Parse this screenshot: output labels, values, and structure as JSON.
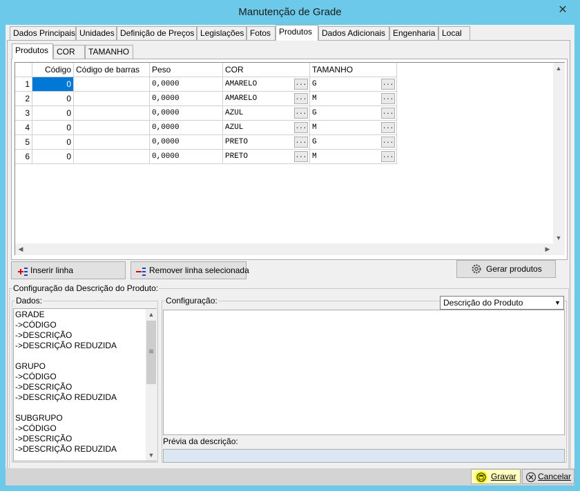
{
  "window": {
    "title": "Manutenção de Grade",
    "close_glyph": "✕"
  },
  "tabs": [
    {
      "label": "Dados Principais"
    },
    {
      "label": "Unidades"
    },
    {
      "label": "Definição de Preços"
    },
    {
      "label": "Legislações"
    },
    {
      "label": "Fotos"
    },
    {
      "label": "Produtos",
      "active": true
    },
    {
      "label": "Dados Adicionais"
    },
    {
      "label": "Engenharia"
    },
    {
      "label": "Local"
    }
  ],
  "subtabs": [
    {
      "label": "Produtos",
      "active": true
    },
    {
      "label": "COR"
    },
    {
      "label": "TAMANHO"
    }
  ],
  "grid": {
    "columns": [
      "Código",
      "Código de barras",
      "Peso",
      "COR",
      "TAMANHO"
    ],
    "rows": [
      {
        "n": "1",
        "codigo": "0",
        "barras": "",
        "peso": "0,0000",
        "cor": "AMARELO",
        "tamanho": "G"
      },
      {
        "n": "2",
        "codigo": "0",
        "barras": "",
        "peso": "0,0000",
        "cor": "AMARELO",
        "tamanho": "M"
      },
      {
        "n": "3",
        "codigo": "0",
        "barras": "",
        "peso": "0,0000",
        "cor": "AZUL",
        "tamanho": "G"
      },
      {
        "n": "4",
        "codigo": "0",
        "barras": "",
        "peso": "0,0000",
        "cor": "AZUL",
        "tamanho": "M"
      },
      {
        "n": "5",
        "codigo": "0",
        "barras": "",
        "peso": "0,0000",
        "cor": "PRETO",
        "tamanho": "G"
      },
      {
        "n": "6",
        "codigo": "0",
        "barras": "",
        "peso": "0,0000",
        "cor": "PRETO",
        "tamanho": "M"
      }
    ],
    "ellipsis": "..."
  },
  "buttons": {
    "insert": "Inserir linha",
    "remove": "Remover linha selecionada",
    "generate": "Gerar produtos",
    "save": "Gravar",
    "cancel": "Cancelar"
  },
  "config": {
    "group_label": "Configuração da Descrição do Produto:",
    "dados_label": "Dados:",
    "config_label": "Configuração:",
    "select_value": "Descrição do Produto",
    "preview_label": "Prévia da descrição:",
    "dados_items": [
      "GRADE",
      "->CÓDIGO",
      "->DESCRIÇÃO",
      "->DESCRIÇÃO REDUZIDA",
      "",
      "GRUPO",
      "->CÓDIGO",
      "->DESCRIÇÃO",
      "->DESCRIÇÃO REDUZIDA",
      "",
      "SUBGRUPO",
      "->CÓDIGO",
      "->DESCRIÇÃO",
      "->DESCRIÇÃO REDUZIDA"
    ]
  },
  "colors": {
    "titlebar": "#6cc9ea",
    "selected_cell": "#0078d7",
    "highlight": "#ffff00"
  }
}
